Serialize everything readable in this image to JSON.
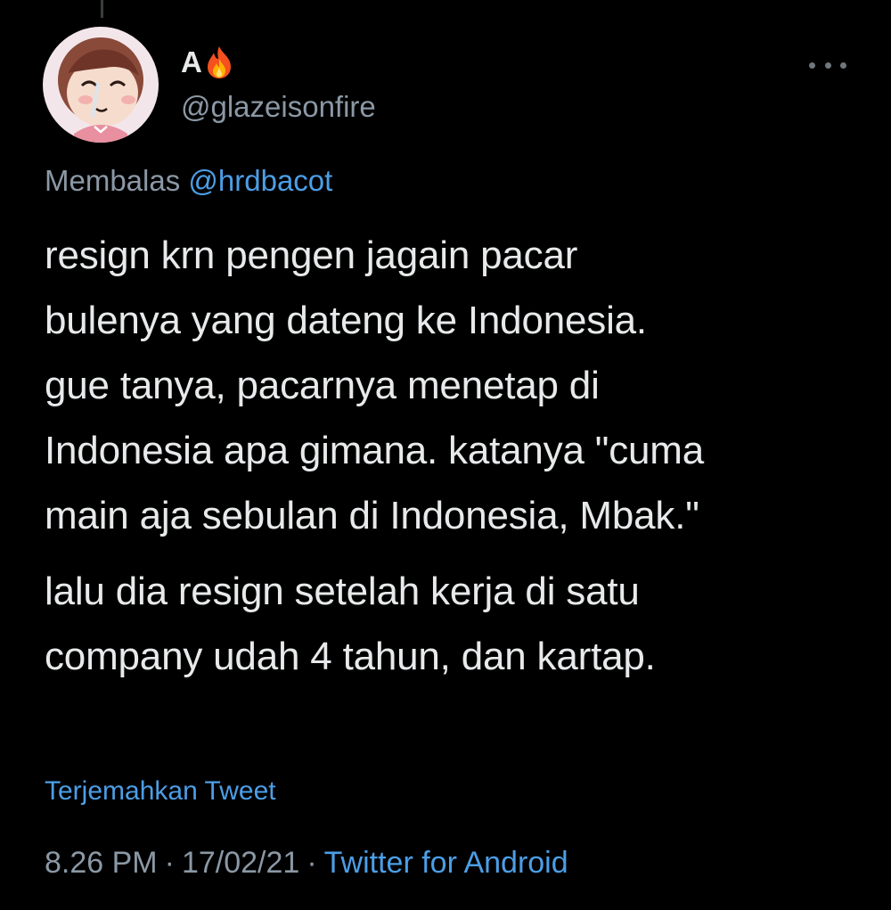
{
  "tweet": {
    "author": {
      "display_name": "A",
      "emoji_icon": "fire-icon",
      "handle": "@glazeisonfire"
    },
    "reply": {
      "prefix": "Membalas",
      "mention": "@hrdbacot"
    },
    "paragraphs": [
      "resign krn pengen jagain pacar\nbulenya yang dateng ke Indonesia.\ngue tanya, pacarnya menetap di\nIndonesia apa gimana. katanya \"cuma\nmain aja sebulan di Indonesia, Mbak.\"",
      "lalu dia resign setelah kerja di satu\ncompany udah 4 tahun, dan kartap."
    ],
    "translate_label": "Terjemahkan Tweet",
    "meta": {
      "time": "8.26 PM",
      "date": "17/02/21",
      "separator": "·",
      "source": "Twitter for Android"
    }
  },
  "colors": {
    "background": "#000000",
    "text": "#e7e9ea",
    "secondary": "#8b98a5",
    "link": "#4c9ee6"
  }
}
